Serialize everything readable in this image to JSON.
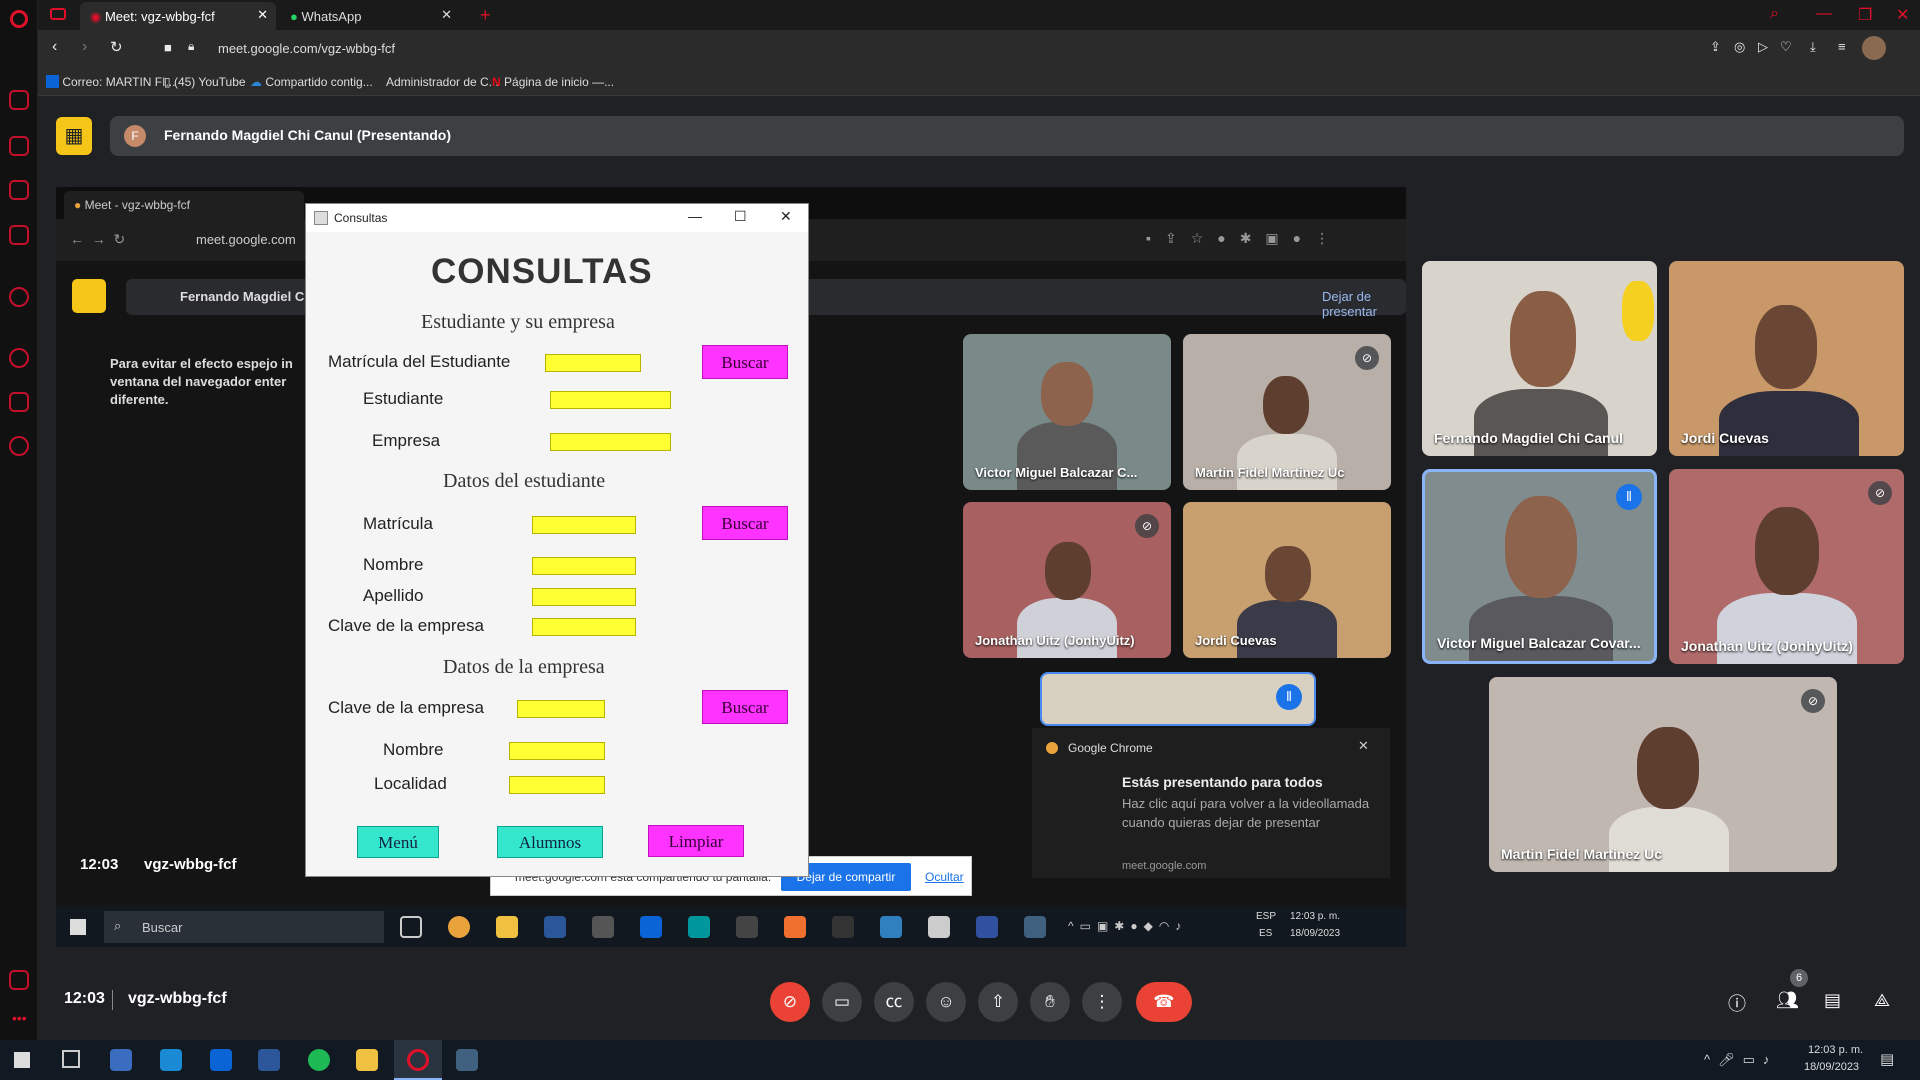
{
  "browser": {
    "tabs": [
      {
        "label": "Meet: vgz-wbbg-fcf",
        "active": true
      },
      {
        "label": "WhatsApp",
        "active": false
      }
    ],
    "url": "meet.google.com/vgz-wbbg-fcf",
    "bookmarks": [
      "Correo: MARTIN FI...",
      "(45) YouTube",
      "Compartido contig...",
      "Administrador de C...",
      "Página de inicio —..."
    ]
  },
  "meet": {
    "presenter_label": "Fernando Magdiel Chi Canul (Presentando)",
    "time": "12:03",
    "meeting_code": "vgz-wbbg-fcf",
    "participants_count": "6",
    "tiles": [
      {
        "name": "Fernando Magdiel Chi Canul",
        "muted": false
      },
      {
        "name": "Jordi Cuevas",
        "muted": false
      },
      {
        "name": "Victor Miguel Balcazar Covar...",
        "speaking": true
      },
      {
        "name": "Jonathan Uitz (JonhyUitz)",
        "muted": true
      },
      {
        "name": "Martin Fidel Martinez Uc",
        "muted": true
      }
    ]
  },
  "shared_screen": {
    "inner_tab": "Meet - vgz-wbbg-fcf",
    "inner_url": "meet.google.com",
    "inner_presenter": "Fernando Magdiel C",
    "stop_presenting": "Dejar de presentar",
    "mirror_hint": "Para evitar el efecto espejo in ventana del navegador enter diferente.",
    "inner_time": "12:03",
    "inner_code": "vgz-wbbg-fcf",
    "inner_tiles": [
      {
        "name": "Victor Miguel Balcazar C..."
      },
      {
        "name": "Martin Fidel Martinez Uc"
      },
      {
        "name": "Jonathan Uitz (JonhyUitz)"
      },
      {
        "name": "Jordi Cuevas"
      }
    ],
    "notification": {
      "app": "Google Chrome",
      "title": "Estás presentando para todos",
      "body": "Haz clic aquí para volver a la videollamada cuando quieras dejar de presentar",
      "source": "meet.google.com"
    },
    "share_bar": {
      "text": "meet.google.com está compartiendo tu pantalla.",
      "stop": "Dejar de compartir",
      "hide": "Ocultar"
    },
    "taskbar": {
      "search": "Buscar",
      "lang1": "ESP",
      "lang2": "ES",
      "time": "12:03 p. m.",
      "date": "18/09/2023"
    }
  },
  "consultas": {
    "window_title": "Consultas",
    "heading": "CONSULTAS",
    "section1": "Estudiante y su empresa",
    "matricula_estudiante": "Matrícula del Estudiante",
    "estudiante": "Estudiante",
    "empresa": "Empresa",
    "section2": "Datos del estudiante",
    "matricula": "Matrícula",
    "nombre": "Nombre",
    "apellido": "Apellido",
    "clave_empresa": "Clave de la empresa",
    "section3": "Datos de la empresa",
    "clave_empresa2": "Clave de la empresa",
    "nombre2": "Nombre",
    "localidad": "Localidad",
    "buscar": "Buscar",
    "menu": "Menú",
    "alumnos": "Alumnos",
    "limpiar": "Limpiar"
  },
  "taskbar": {
    "time": "12:03 p. m.",
    "date": "18/09/2023"
  },
  "colors": {
    "field": "#ffff33",
    "button_pink": "#ff33ff",
    "button_cyan": "#33e6cc",
    "hangup": "#ea4335",
    "meet_blue": "#1a73e8"
  }
}
